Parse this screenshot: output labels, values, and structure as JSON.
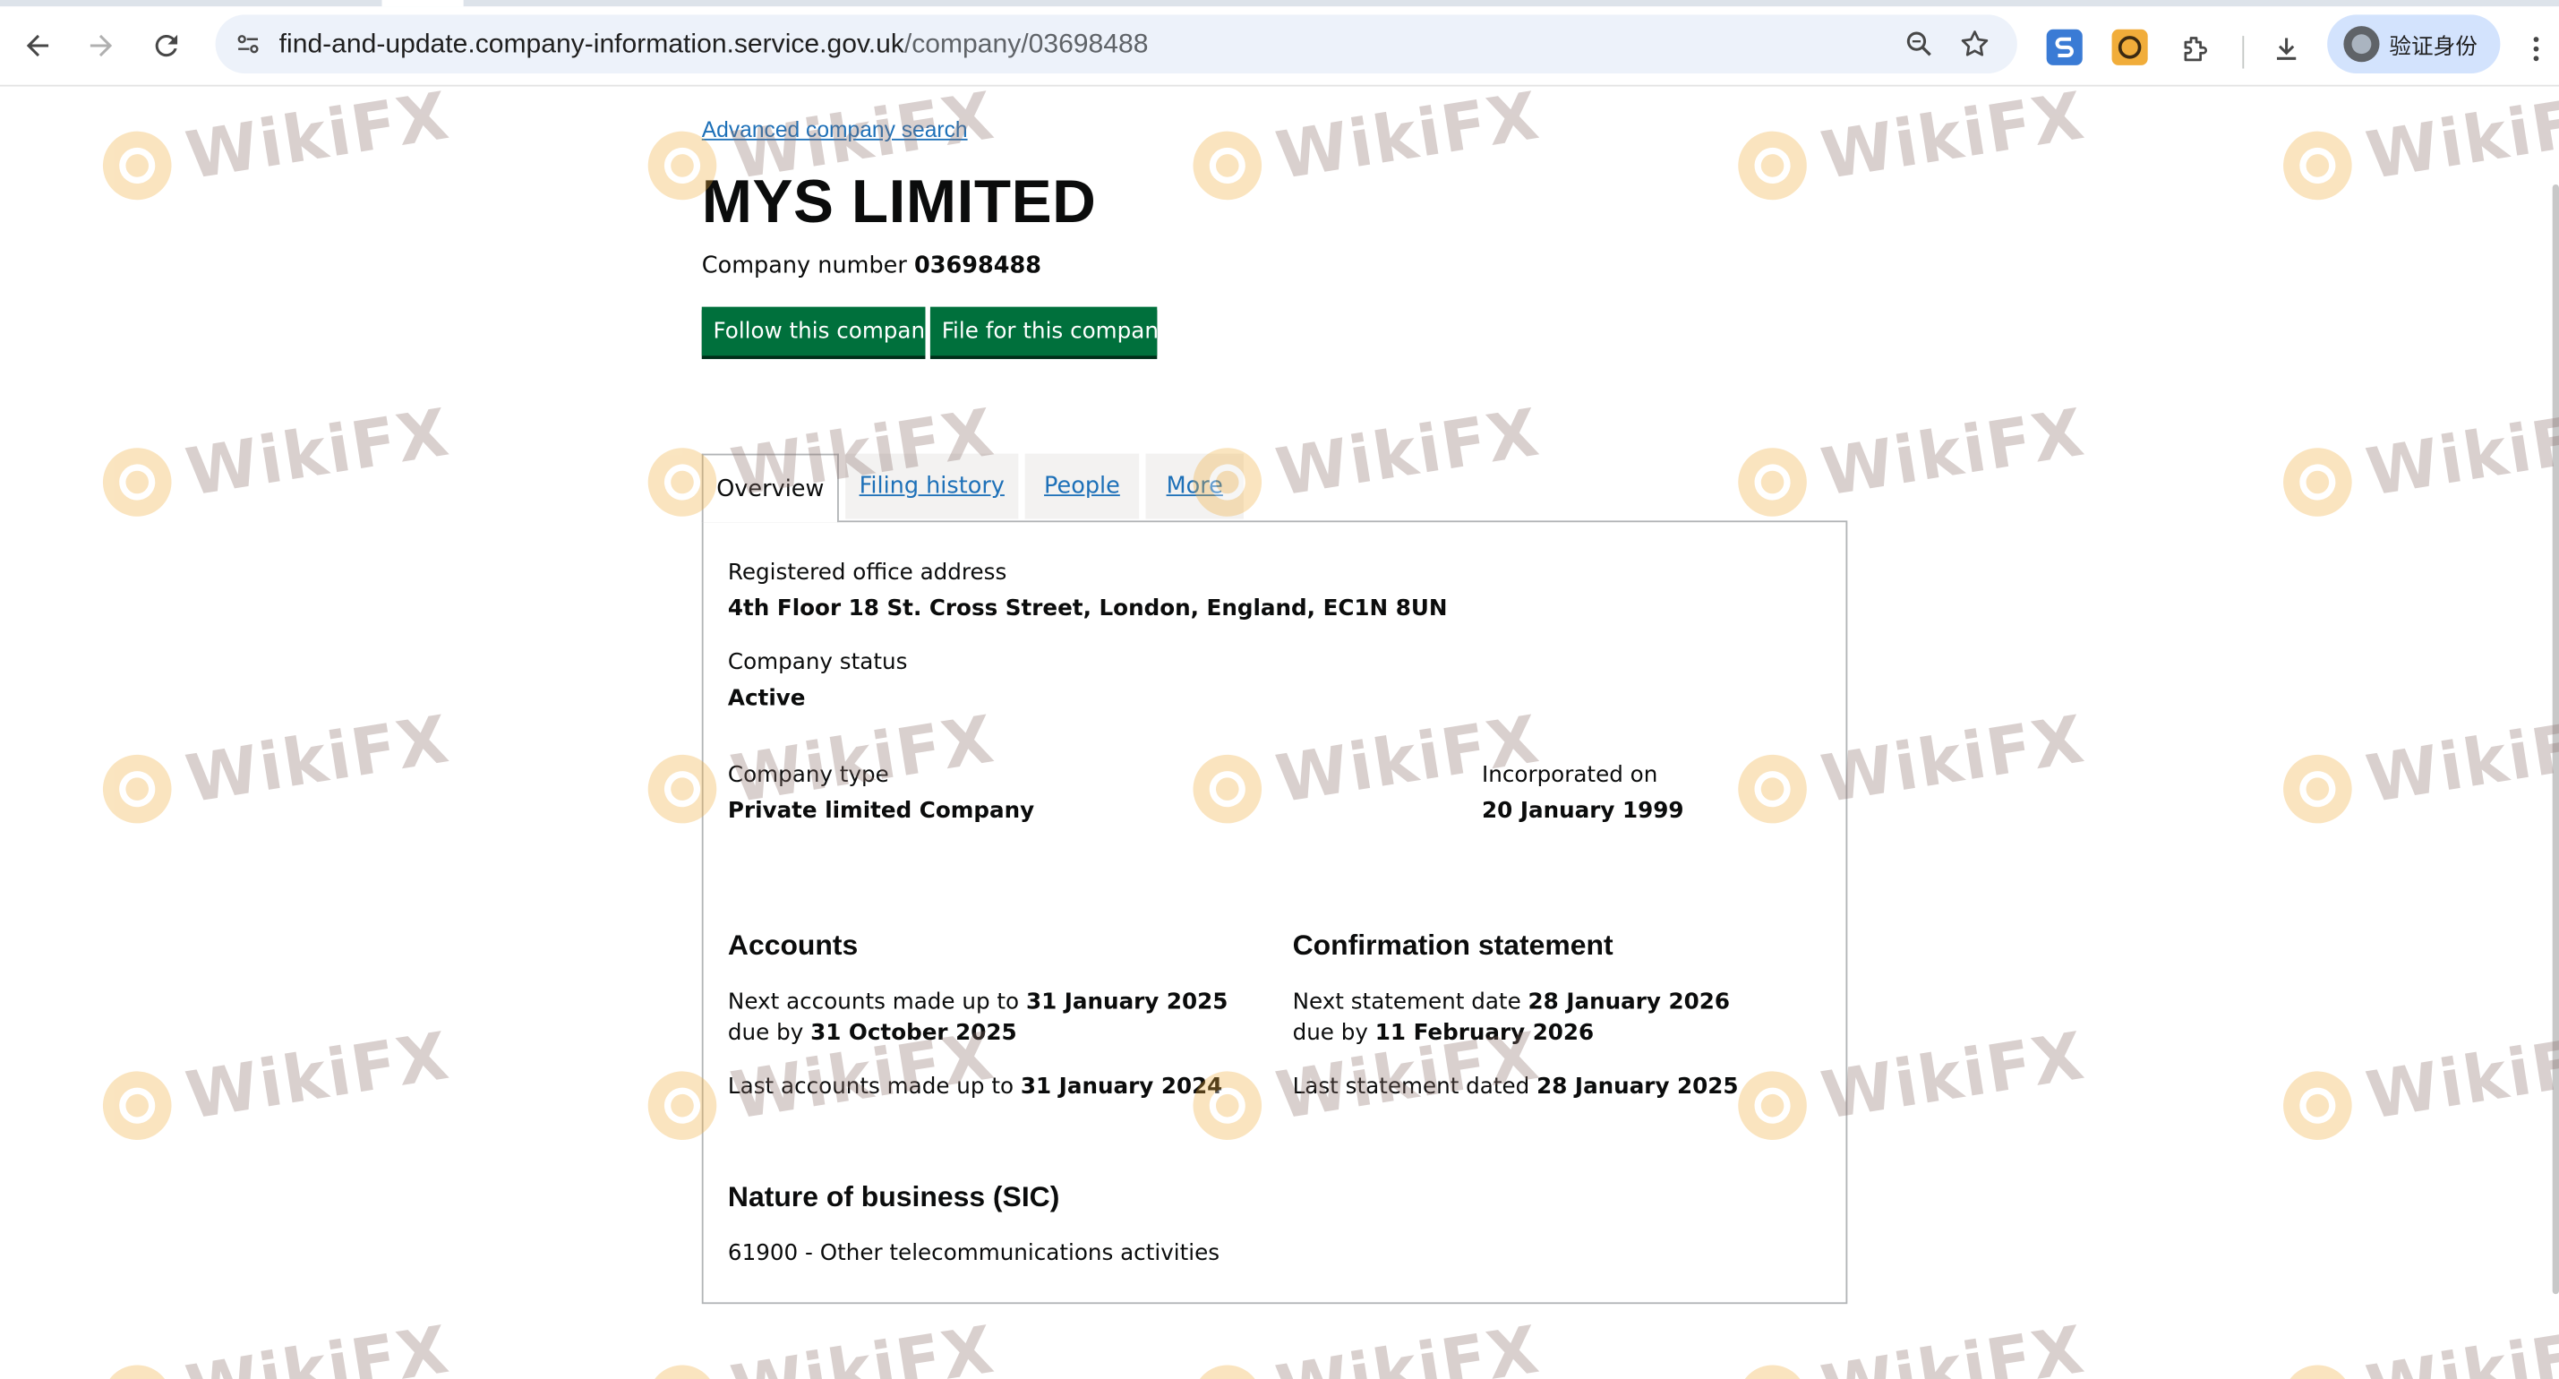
{
  "browser": {
    "url_host": "find-and-update.company-information.service.gov.uk",
    "url_path": "/company/03698488",
    "profile_label": "验证身份"
  },
  "page": {
    "advanced_search_link": "Advanced company search",
    "company_name": "MYS LIMITED",
    "company_number_label": "Company number",
    "company_number": "03698488",
    "buttons": {
      "follow": "Follow this company",
      "file": "File for this company"
    },
    "tabs": [
      {
        "label": "Overview",
        "active": true
      },
      {
        "label": "Filing history",
        "active": false
      },
      {
        "label": "People",
        "active": false
      },
      {
        "label": "More",
        "active": false
      }
    ],
    "overview": {
      "registered_office_label": "Registered office address",
      "registered_office_value": "4th Floor 18 St. Cross Street, London, England, EC1N 8UN",
      "status_label": "Company status",
      "status_value": "Active",
      "type_label": "Company type",
      "type_value": "Private limited Company",
      "incorporated_label": "Incorporated on",
      "incorporated_value": "20 January 1999"
    },
    "accounts": {
      "heading": "Accounts",
      "next_made_up_label": "Next accounts made up to",
      "next_made_up_value": "31 January 2025",
      "due_by_label": "due by",
      "due_by_value": "31 October 2025",
      "last_made_up_label": "Last accounts made up to",
      "last_made_up_value": "31 January 2024"
    },
    "confirmation": {
      "heading": "Confirmation statement",
      "next_date_label": "Next statement date",
      "next_date_value": "28 January 2026",
      "due_by_label": "due by",
      "due_by_value": "11 February 2026",
      "last_dated_label": "Last statement dated",
      "last_dated_value": "28 January 2025"
    },
    "sic": {
      "heading": "Nature of business (SIC)",
      "item": "61900 - Other telecommunications activities"
    }
  },
  "watermark_text": "WikiFX",
  "colors": {
    "govuk_green": "#00703c",
    "link_blue": "#1d70b8",
    "watermark_orange": "#f1ad3a"
  }
}
